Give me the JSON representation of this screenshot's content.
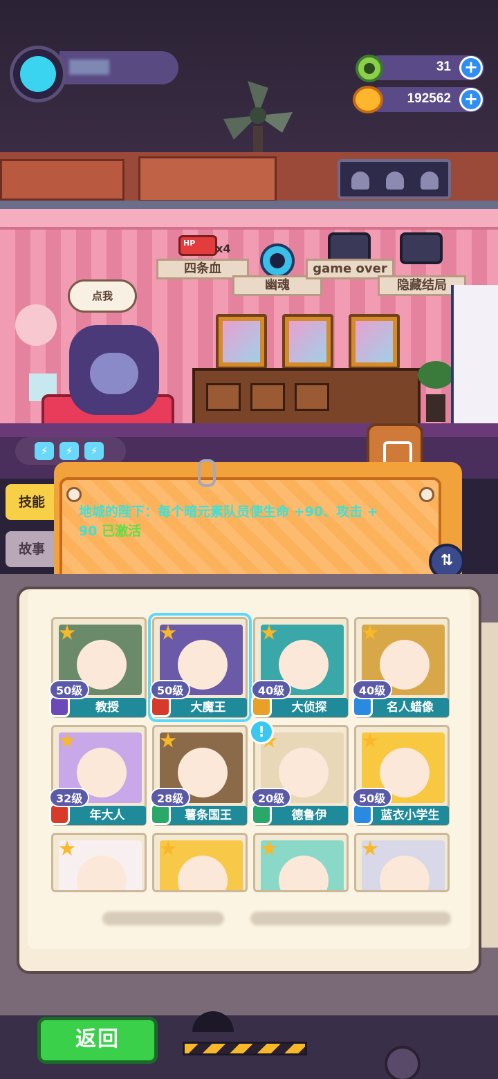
{
  "resources": {
    "gems": "31",
    "coins": "192562",
    "plus": "+"
  },
  "stage": {
    "speech": "点我",
    "labels": [
      "四条血",
      "幽魂",
      "game over",
      "隐藏结局"
    ],
    "hp_badge": "HP",
    "hp_multiplier": "x4",
    "energy_count": 3
  },
  "tabs": {
    "skill": "技能",
    "story": "故事"
  },
  "skill_panel": {
    "text": "地城的陛下：每个暗元素队员使生命 +90、攻击 +",
    "text2": "90",
    "status": "已激活"
  },
  "roster": [
    {
      "name": "教授",
      "level": "50级",
      "element": "purple",
      "bg": "#6a8a6a"
    },
    {
      "name": "大魔王",
      "level": "50级",
      "element": "red",
      "bg": "#6a5aa8",
      "selected": true
    },
    {
      "name": "大侦探",
      "level": "40级",
      "element": "gold",
      "bg": "#3aa8a8"
    },
    {
      "name": "名人蜡像",
      "level": "40级",
      "element": "blue",
      "bg": "#d8a848"
    },
    {
      "name": "年大人",
      "level": "32级",
      "element": "red",
      "bg": "#c8a8e8"
    },
    {
      "name": "薯条国王",
      "level": "28级",
      "element": "green",
      "bg": "#8a6a48"
    },
    {
      "name": "德鲁伊",
      "level": "20级",
      "element": "green",
      "bg": "#e8d8b8"
    },
    {
      "name": "蓝衣小学生",
      "level": "50级",
      "element": "blue",
      "bg": "#f8c840"
    },
    {
      "bg": "#f8f0f0"
    },
    {
      "bg": "#f8c848"
    },
    {
      "bg": "#8ad8c8"
    },
    {
      "bg": "#d8d8e8"
    }
  ],
  "element_colors": {
    "purple": "#6a4ab8",
    "red": "#d83a2a",
    "gold": "#e8a028",
    "blue": "#2a8ae0",
    "green": "#2aa868"
  },
  "back_button": "返回"
}
